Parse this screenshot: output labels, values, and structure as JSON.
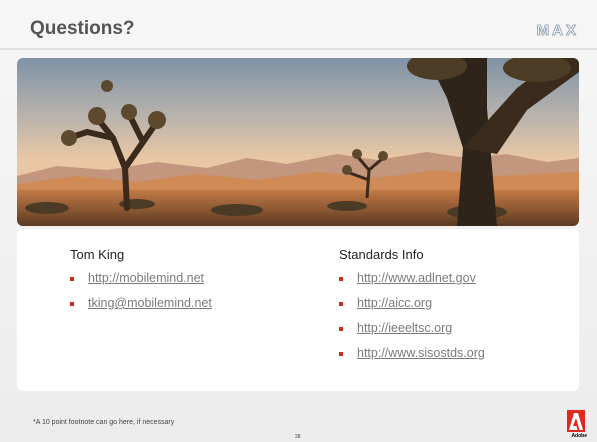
{
  "slide": {
    "title": "Questions?",
    "brand_logo": "MAX",
    "footnote": "*A 10 point footnote can go here, if necessary",
    "page_number": "28",
    "vendor_logo_text": "Adobe"
  },
  "photo": {
    "description_icon": "desert-joshua-tree-image"
  },
  "left_column": {
    "heading": "Tom King",
    "links": [
      "http://mobilemind.net",
      "tking@mobilemind.net"
    ]
  },
  "right_column": {
    "heading": "Standards Info",
    "links": [
      "http://www.adlnet.gov",
      "http://aicc.org",
      "http://ieeeltsc.org",
      "http://www.sisostds.org"
    ]
  },
  "colors": {
    "bullet": "#cc2a1e",
    "link": "#7a7a7a",
    "title": "#555555"
  }
}
